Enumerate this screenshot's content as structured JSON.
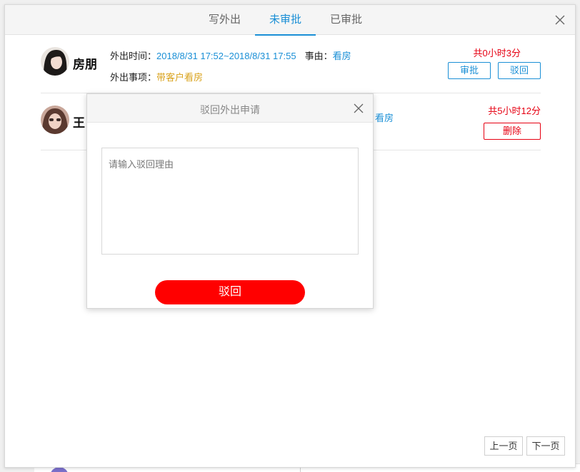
{
  "tabs": [
    {
      "label": "写外出",
      "active": false
    },
    {
      "label": "未审批",
      "active": true
    },
    {
      "label": "已审批",
      "active": false
    }
  ],
  "records": [
    {
      "name": "房朋",
      "time_label": "外出时间：",
      "time_value": "2018/8/31 17:52~2018/8/31 17:55",
      "reason_label": "事由：",
      "reason_value": "看房",
      "item_label": "外出事项：",
      "item_value": "带客户看房",
      "duration": "共0小时3分",
      "approve_label": "审批",
      "reject_label": "驳回"
    },
    {
      "name": "王?",
      "name_visible": "王",
      "reason_value_partial": "看房",
      "duration": "共5小时12分",
      "delete_label": "删除"
    }
  ],
  "pagination": {
    "prev": "上一页",
    "next": "下一页"
  },
  "reject_dialog": {
    "title": "驳回外出申请",
    "placeholder": "请输入驳回理由",
    "submit_label": "驳回"
  },
  "colors": {
    "accent_blue": "#1a8fd6",
    "danger_red": "#e60012",
    "submit_red": "#ff0000",
    "highlight_orange": "#d9a21b"
  },
  "icons": {
    "close": "close-icon",
    "avatar_1": "avatar",
    "avatar_2": "avatar"
  }
}
